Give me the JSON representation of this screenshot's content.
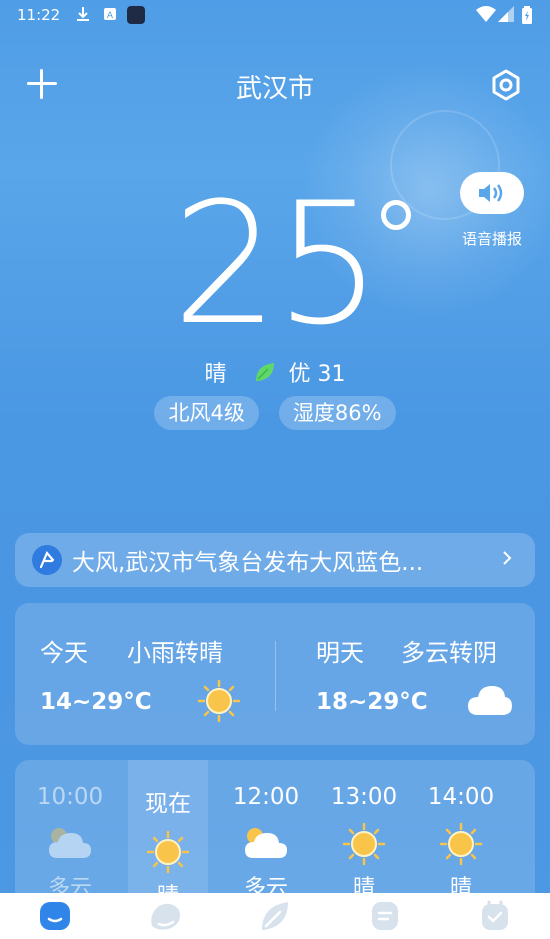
{
  "status_bar": {
    "time": "11:22"
  },
  "header": {
    "city": "武汉市"
  },
  "current": {
    "temperature": "25",
    "condition": "晴",
    "aqi": "优 31",
    "wind": "北风4级",
    "humidity": "湿度86%"
  },
  "voice": {
    "label": "语音播报"
  },
  "alert": {
    "text": "大风,武汉市气象台发布大风蓝色..."
  },
  "forecast": {
    "today": {
      "day": "今天",
      "condition": "小雨转晴",
      "range": "14~29°C",
      "icon": "sun-icon"
    },
    "tomorrow": {
      "day": "明天",
      "condition": "多云转阴",
      "range": "18~29°C",
      "icon": "cloud-icon"
    }
  },
  "hourly": [
    {
      "time": "10:00",
      "condition": "多云",
      "icon": "partly-cloudy-icon",
      "state": "past"
    },
    {
      "time": "现在",
      "condition": "晴",
      "icon": "sun-icon",
      "state": "now"
    },
    {
      "time": "12:00",
      "condition": "多云",
      "icon": "partly-cloudy-icon",
      "state": "future"
    },
    {
      "time": "13:00",
      "condition": "晴",
      "icon": "sun-icon",
      "state": "future"
    },
    {
      "time": "14:00",
      "condition": "晴",
      "icon": "sun-icon",
      "state": "future"
    }
  ],
  "nav": [
    "weather-tab-icon",
    "forecast-tab-icon",
    "air-tab-icon",
    "news-tab-icon",
    "tools-tab-icon"
  ],
  "colors": {
    "accent": "#2f7be0",
    "sun": "#f8c54a",
    "leaf": "#5fd86a"
  }
}
